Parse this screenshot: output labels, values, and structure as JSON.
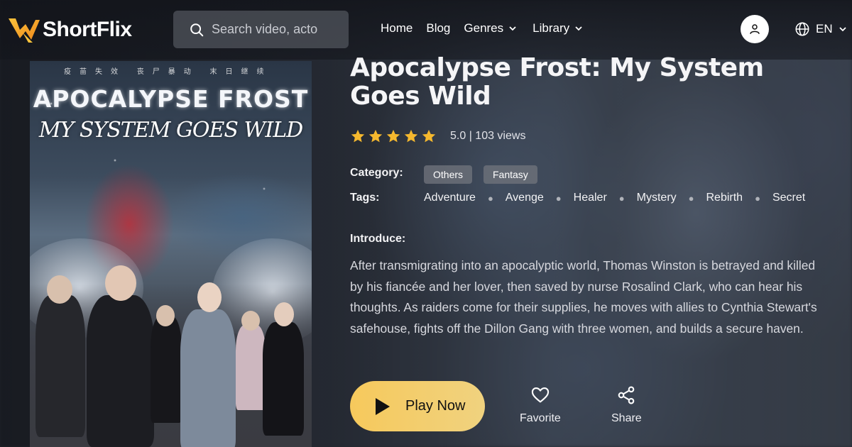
{
  "header": {
    "brand": "ShortFlix",
    "search_placeholder": "Search video, actor",
    "nav": [
      {
        "label": "Home",
        "has_dropdown": false
      },
      {
        "label": "Blog",
        "has_dropdown": false
      },
      {
        "label": "Genres",
        "has_dropdown": true
      },
      {
        "label": "Library",
        "has_dropdown": true
      }
    ],
    "language": "EN",
    "icons": {
      "search": "search-icon",
      "user": "user-icon",
      "globe": "globe-icon",
      "chevron": "chevron-down-icon"
    }
  },
  "poster": {
    "tagline": "疫苗失效 丧尸暴动 末日继续",
    "title_line1": "APOCALYPSE FROST",
    "title_line2": "MY SYSTEM GOES WILD"
  },
  "show": {
    "title": "Apocalypse Frost: My System Goes Wild",
    "rating_stars": 5,
    "rating_text": "5.0 | 103 views",
    "category_label": "Category:",
    "categories": [
      "Others",
      "Fantasy"
    ],
    "tags_label": "Tags:",
    "tags": [
      "Adventure",
      "Avenge",
      "Healer",
      "Mystery",
      "Rebirth",
      "Secret"
    ],
    "intro_label": "Introduce:",
    "intro": "After transmigrating into an apocalyptic world, Thomas Winston is betrayed and killed by his fiancée and her lover, then saved by nurse Rosalind Clark, who can hear his thoughts. As raiders come for their supplies, he moves with allies to Cynthia Stewart's safehouse, fights off the Dillon Gang with three women, and builds a secure haven."
  },
  "actions": {
    "play": "Play Now",
    "favorite": "Favorite",
    "share": "Share"
  },
  "colors": {
    "accent": "#f6c95c",
    "star": "#f5b82e",
    "chip_bg": "#6e727a"
  }
}
